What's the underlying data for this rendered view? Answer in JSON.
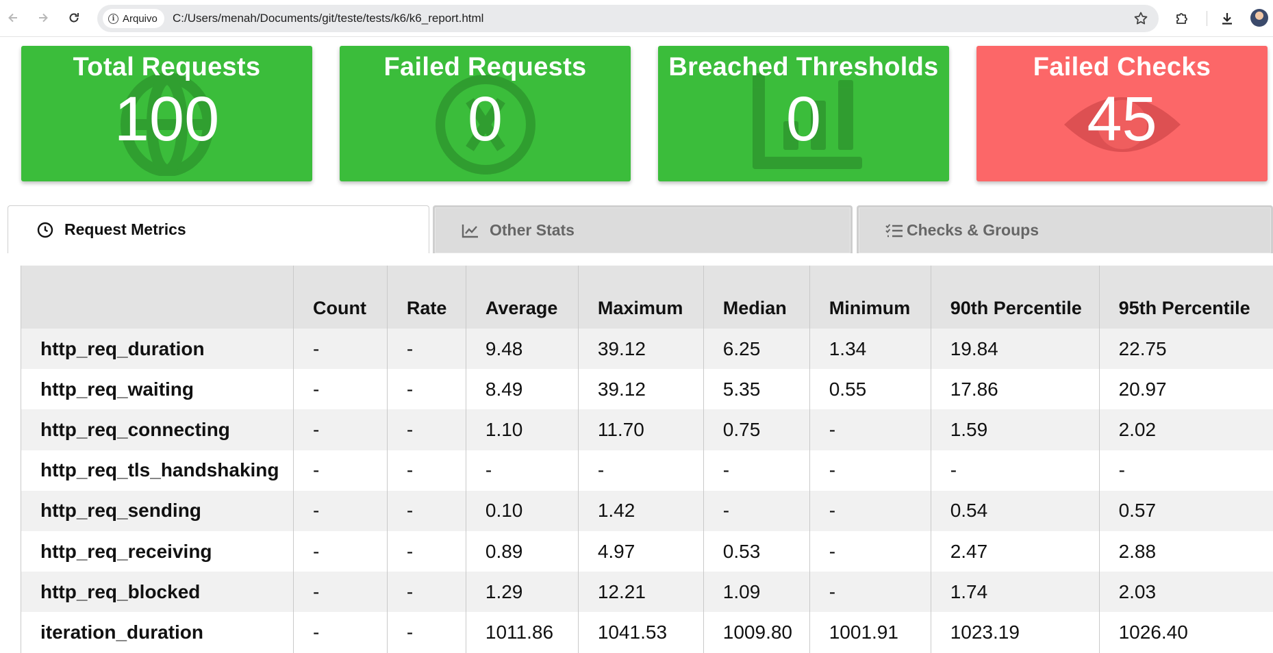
{
  "browser": {
    "security_chip": "Arquivo",
    "url": "C:/Users/menah/Documents/git/teste/tests/k6/k6_report.html"
  },
  "cards": [
    {
      "title": "Total Requests",
      "value": "100",
      "color": "#3bbd3b",
      "icon": "globe-icon"
    },
    {
      "title": "Failed Requests",
      "value": "0",
      "color": "#3bbd3b",
      "icon": "ban-icon"
    },
    {
      "title": "Breached Thresholds",
      "value": "0",
      "color": "#3bbd3b",
      "icon": "chart-icon"
    },
    {
      "title": "Failed Checks",
      "value": "45",
      "color": "#fc6768",
      "icon": "eye-icon"
    }
  ],
  "tabs": [
    {
      "label": "Request Metrics",
      "icon": "clock-icon",
      "active": true
    },
    {
      "label": "Other Stats",
      "icon": "line-chart-icon",
      "active": false
    },
    {
      "label": "Checks & Groups",
      "icon": "checklist-icon",
      "active": false
    }
  ],
  "table": {
    "headers": [
      "",
      "Count",
      "Rate",
      "Average",
      "Maximum",
      "Median",
      "Minimum",
      "90th Percentile",
      "95th Percentile"
    ],
    "rows": [
      [
        "http_req_duration",
        "-",
        "-",
        "9.48",
        "39.12",
        "6.25",
        "1.34",
        "19.84",
        "22.75"
      ],
      [
        "http_req_waiting",
        "-",
        "-",
        "8.49",
        "39.12",
        "5.35",
        "0.55",
        "17.86",
        "20.97"
      ],
      [
        "http_req_connecting",
        "-",
        "-",
        "1.10",
        "11.70",
        "0.75",
        "-",
        "1.59",
        "2.02"
      ],
      [
        "http_req_tls_handshaking",
        "-",
        "-",
        "-",
        "-",
        "-",
        "-",
        "-",
        "-"
      ],
      [
        "http_req_sending",
        "-",
        "-",
        "0.10",
        "1.42",
        "-",
        "-",
        "0.54",
        "0.57"
      ],
      [
        "http_req_receiving",
        "-",
        "-",
        "0.89",
        "4.97",
        "0.53",
        "-",
        "2.47",
        "2.88"
      ],
      [
        "http_req_blocked",
        "-",
        "-",
        "1.29",
        "12.21",
        "1.09",
        "-",
        "1.74",
        "2.03"
      ],
      [
        "iteration_duration",
        "-",
        "-",
        "1011.86",
        "1041.53",
        "1009.80",
        "1001.91",
        "1023.19",
        "1026.40"
      ]
    ]
  }
}
